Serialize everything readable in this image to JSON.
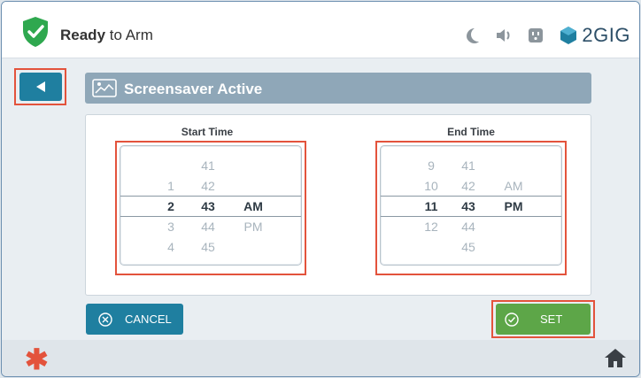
{
  "header": {
    "status_bold": "Ready",
    "status_rest": " to Arm",
    "brand": "2GIG",
    "icons": [
      "shield-check-icon",
      "moon-icon",
      "speaker-icon",
      "outlet-icon",
      "2gig-cube-icon"
    ]
  },
  "page": {
    "title": "Screensaver Active",
    "title_icon": "screensaver-picture-icon",
    "back_icon": "back-triangle-icon"
  },
  "start_time": {
    "label": "Start Time",
    "rows": [
      {
        "hour": "",
        "minute": "41",
        "ampm": ""
      },
      {
        "hour": "1",
        "minute": "42",
        "ampm": ""
      },
      {
        "hour": "2",
        "minute": "43",
        "ampm": "AM"
      },
      {
        "hour": "3",
        "minute": "44",
        "ampm": "PM"
      },
      {
        "hour": "4",
        "minute": "45",
        "ampm": ""
      }
    ],
    "selected_index": 2
  },
  "end_time": {
    "label": "End Time",
    "rows": [
      {
        "hour": "9",
        "minute": "41",
        "ampm": ""
      },
      {
        "hour": "10",
        "minute": "42",
        "ampm": "AM"
      },
      {
        "hour": "11",
        "minute": "43",
        "ampm": "PM"
      },
      {
        "hour": "12",
        "minute": "44",
        "ampm": ""
      },
      {
        "hour": "",
        "minute": "45",
        "ampm": ""
      }
    ],
    "selected_index": 2
  },
  "buttons": {
    "cancel": "CANCEL",
    "set": "SET"
  },
  "footer": {
    "left_icon": "asterisk-icon",
    "right_icon": "home-icon"
  },
  "colors": {
    "accent_teal": "#1f7fa0",
    "confirm_green": "#5da648",
    "highlight_red": "#e3533c",
    "shield_green": "#2fa84f"
  }
}
